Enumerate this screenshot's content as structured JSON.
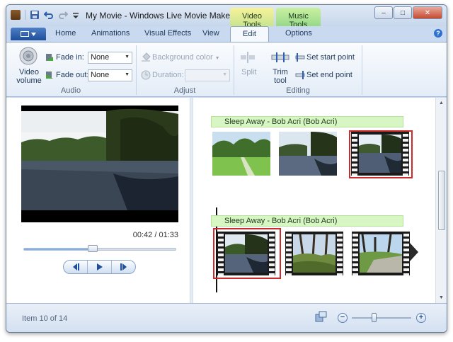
{
  "window": {
    "title": "My Movie - Windows Live Movie Maker",
    "context_tabs": {
      "video_tools": "Video Tools",
      "music_tools": "Music Tools"
    },
    "controls": {
      "minimize": "–",
      "maximize": "□",
      "close": "✕"
    }
  },
  "tabs": [
    {
      "label": "Home",
      "active": false
    },
    {
      "label": "Animations",
      "active": false
    },
    {
      "label": "Visual Effects",
      "active": false
    },
    {
      "label": "View",
      "active": false
    },
    {
      "label": "Edit",
      "active": true
    },
    {
      "label": "Options",
      "active": false
    }
  ],
  "ribbon": {
    "audio": {
      "group_label": "Audio",
      "video_volume": "Video volume",
      "fade_in_label": "Fade in:",
      "fade_in_value": "None",
      "fade_out_label": "Fade out:",
      "fade_out_value": "None"
    },
    "adjust": {
      "group_label": "Adjust",
      "background_color": "Background color",
      "duration_label": "Duration:",
      "duration_value": ""
    },
    "editing": {
      "group_label": "Editing",
      "split": "Split",
      "trim_tool": "Trim tool",
      "set_start_point": "Set start point",
      "set_end_point": "Set end point"
    }
  },
  "preview": {
    "time_current": "00:42",
    "time_separator": " / ",
    "time_total": "01:33",
    "position_fraction": 0.45
  },
  "storyboard": {
    "rows": [
      {
        "audio_label": "Sleep Away - Bob Acri (Bob Acri)"
      },
      {
        "audio_label": "Sleep Away - Bob Acri (Bob Acri)"
      }
    ]
  },
  "status": {
    "item_text": "Item 10 of 14",
    "zoom_fraction": 0.38
  },
  "colors": {
    "accent": "#1f4f9c",
    "selection": "#cc2b2b",
    "audio_bar": "#d8f5c4",
    "video_tools_tab": "#f7f29a",
    "music_tools_tab": "#c9f0a0"
  }
}
